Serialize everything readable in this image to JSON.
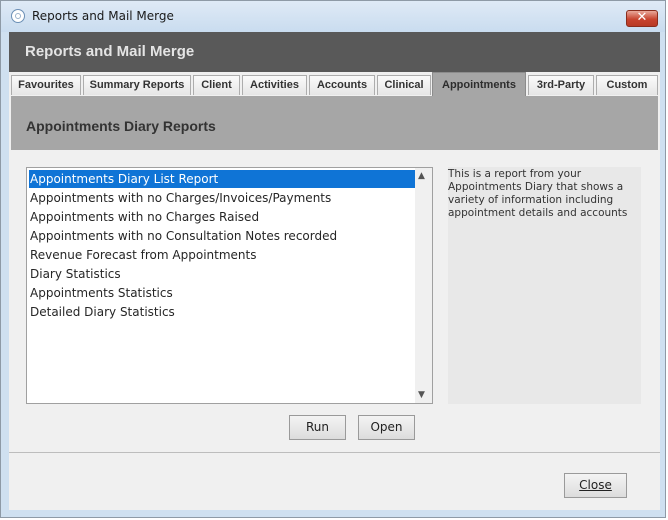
{
  "window": {
    "title": "Reports and Mail Merge"
  },
  "header": {
    "title": "Reports and Mail Merge"
  },
  "tabs": [
    {
      "label": "Favourites"
    },
    {
      "label": "Summary Reports"
    },
    {
      "label": "Client"
    },
    {
      "label": "Activities"
    },
    {
      "label": "Accounts"
    },
    {
      "label": "Clinical"
    },
    {
      "label": "Appointments"
    },
    {
      "label": "3rd-Party"
    },
    {
      "label": "Custom"
    }
  ],
  "active_tab": "Appointments",
  "section": {
    "title": "Appointments Diary Reports"
  },
  "reports": [
    {
      "label": "Appointments Diary List Report"
    },
    {
      "label": "Appointments with no Charges/Invoices/Payments"
    },
    {
      "label": "Appointments with no Charges Raised"
    },
    {
      "label": "Appointments with no Consultation Notes recorded"
    },
    {
      "label": "Revenue Forecast from Appointments"
    },
    {
      "label": "Diary Statistics"
    },
    {
      "label": "Appointments Statistics"
    },
    {
      "label": "Detailed Diary Statistics"
    }
  ],
  "selected_report": "Appointments Diary List Report",
  "description": "This is a report from your Appointments Diary that shows a variety of information including appointment details and accounts",
  "buttons": {
    "run": "Run",
    "open": "Open",
    "close": "Close"
  },
  "icons": {
    "app": "app-logo-icon",
    "close": "close-icon",
    "scroll_up": "chevron-up-icon",
    "scroll_down": "chevron-down-icon"
  },
  "colors": {
    "header": "#595959",
    "section": "#a6a6a6",
    "selection": "#0f74d6",
    "close_button": "#c8442f"
  }
}
